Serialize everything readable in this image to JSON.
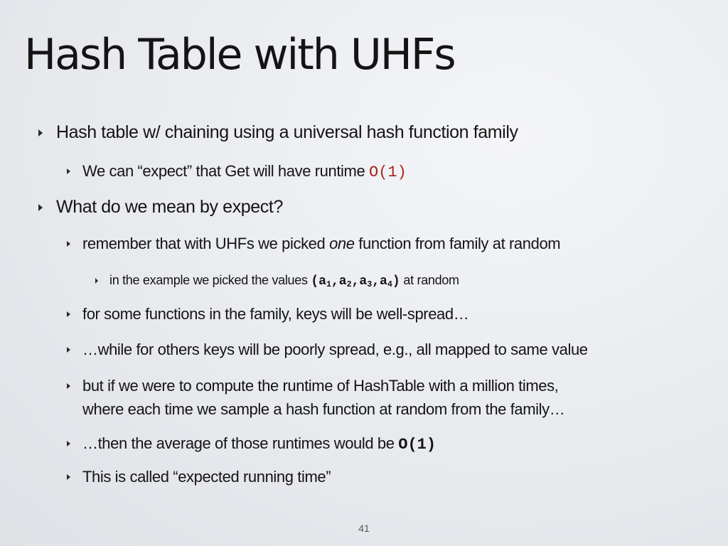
{
  "title": "Hash Table with UHFs",
  "bullets": {
    "b1": "Hash table w/ chaining using a universal hash function family",
    "b1_1_pre": "We can “expect” that Get will have runtime ",
    "b1_1_code": "O(1)",
    "b2": "What do we mean  by expect?",
    "b2_1_pre": "remember that with UHFs we picked ",
    "b2_1_em": "one",
    "b2_1_post": " function from family at random",
    "b2_1_1_pre": "in the example we picked the values ",
    "b2_1_1_code": {
      "open": "(a",
      "s1": "1",
      "c1": ",a",
      "s2": "2",
      "c2": ",a",
      "s3": "3",
      "c3": ",a",
      "s4": "4",
      "close": ")"
    },
    "b2_1_1_post": " at random",
    "b2_2": "for some functions in the family, keys will be well-spread…",
    "b2_3": "…while for others keys will be poorly spread, e.g., all mapped to same value",
    "b2_4_line1": "but if we were to compute the runtime of HashTable with a million times,",
    "b2_4_line2": "where each time we sample a hash function at random from the family…",
    "b2_5_pre": "…then the average of those runtimes would be ",
    "b2_5_code": "O(1)",
    "b2_6": "This is called “expected running time”"
  },
  "page_number": "41"
}
